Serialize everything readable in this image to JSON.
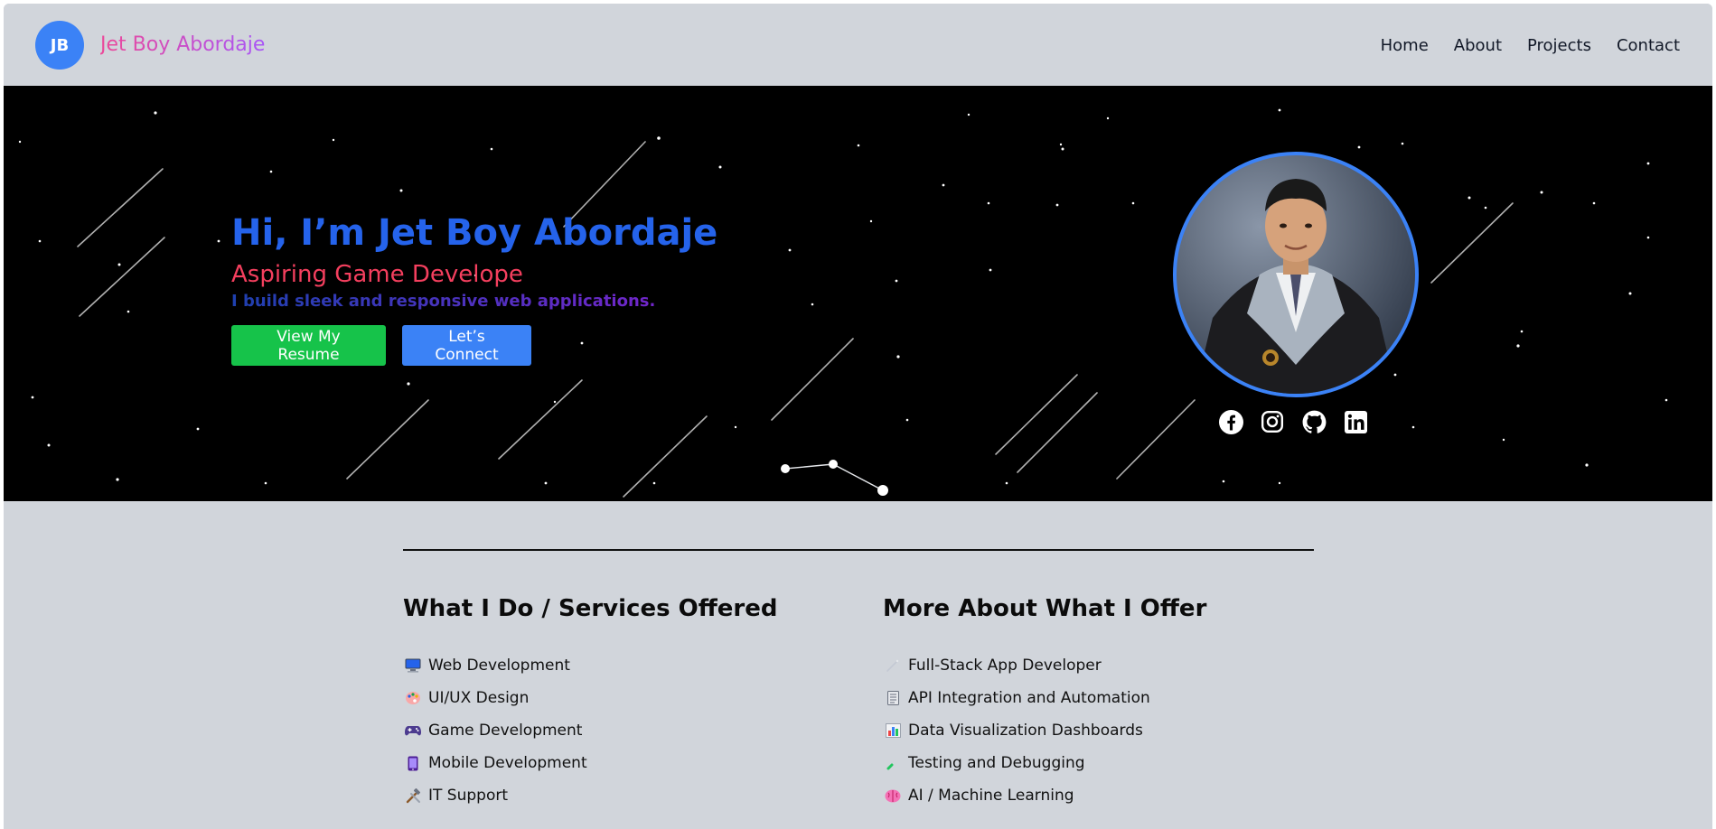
{
  "nav": {
    "logo_initials": "JB",
    "brand": "Jet Boy Abordaje",
    "links": [
      "Home",
      "About",
      "Projects",
      "Contact"
    ]
  },
  "hero": {
    "title": "Hi, I’m Jet Boy Abordaje",
    "subtitle": "Aspiring Game Develope",
    "tagline": "I build sleek and responsive web applications.",
    "resume_button": "View My Resume",
    "connect_button": "Let’s Connect",
    "socials": [
      "facebook-icon",
      "instagram-icon",
      "github-icon",
      "linkedin-icon"
    ]
  },
  "services": {
    "heading": "What I Do / Services Offered",
    "items": [
      {
        "icon": "computer-icon",
        "label": "Web Development"
      },
      {
        "icon": "palette-icon",
        "label": "UI/UX Design"
      },
      {
        "icon": "gamepad-icon",
        "label": "Game Development"
      },
      {
        "icon": "mobile-icon",
        "label": "Mobile Development"
      },
      {
        "icon": "hammer-wrench-icon",
        "label": "IT Support"
      }
    ]
  },
  "offer": {
    "heading": "More About What I Offer",
    "items": [
      {
        "icon": "wand-icon",
        "label": "Full-Stack App Developer"
      },
      {
        "icon": "document-icon",
        "label": "API Integration and Automation"
      },
      {
        "icon": "bar-chart-icon",
        "label": "Data Visualization Dashboards"
      },
      {
        "icon": "test-tube-icon",
        "label": "Testing and Debugging"
      },
      {
        "icon": "brain-icon",
        "label": "AI / Machine Learning"
      }
    ]
  },
  "colors": {
    "accent_blue": "#3b82f6",
    "title_blue": "#2563eb",
    "subtitle_pink": "#f43f5e",
    "button_green": "#16c34a",
    "page_gray": "#d1d5db"
  }
}
